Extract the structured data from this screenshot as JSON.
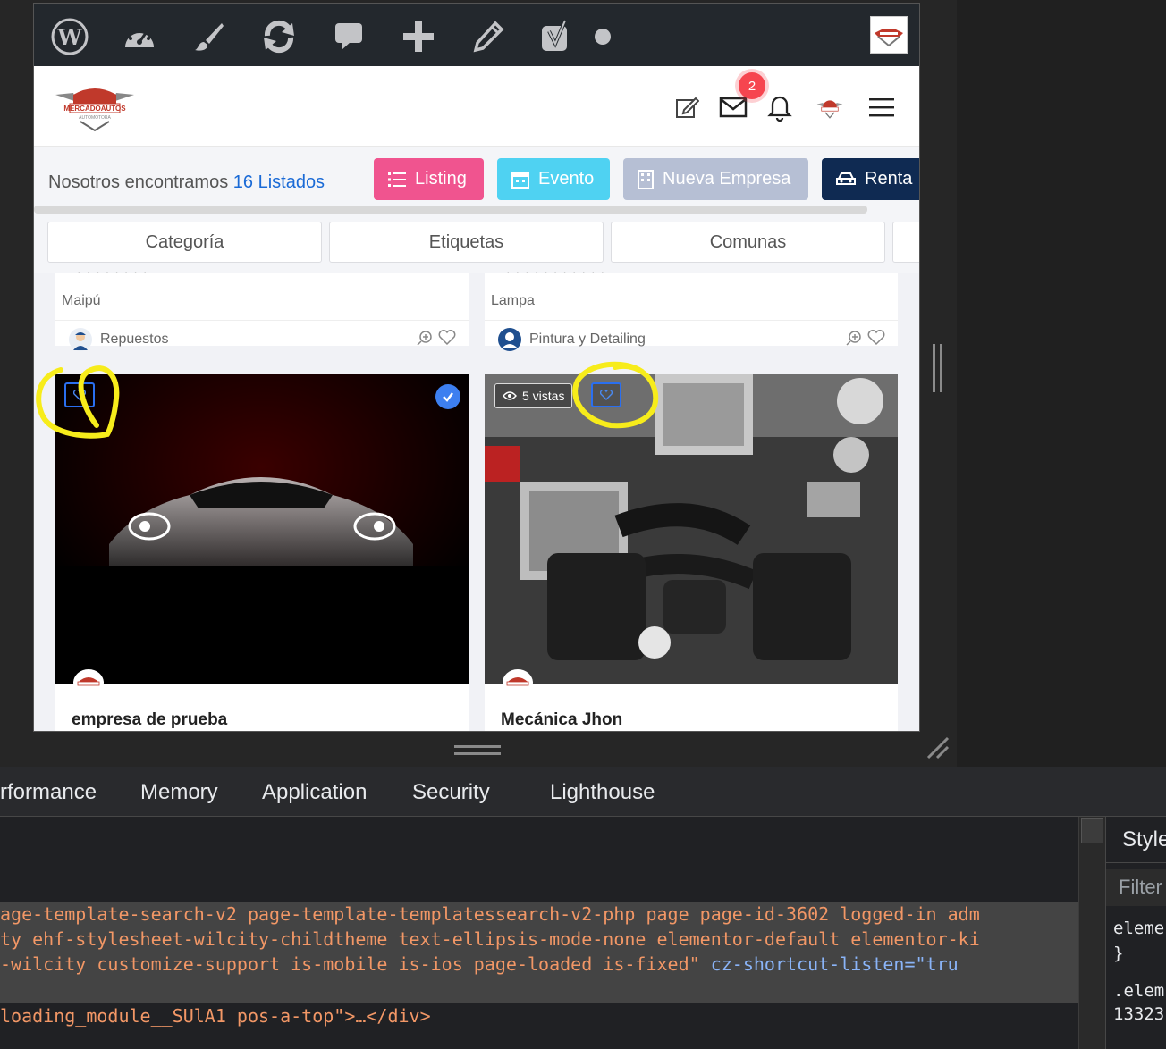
{
  "admin_bar": {
    "icons": [
      "wordpress-icon",
      "dashboard-icon",
      "customize-brush-icon",
      "updates-icon",
      "comments-icon",
      "new-content-icon",
      "edit-icon",
      "yoast-icon",
      "status-dot-icon"
    ]
  },
  "header": {
    "logo_text": "MERCADOAUTOS",
    "logo_sub": "AUTOMOTORA",
    "mail_badge": "2"
  },
  "found_bar": {
    "prefix": "Nosotros encontramos",
    "count": "16 Listados",
    "buttons": [
      {
        "label": "Listing",
        "color": "#f0548f"
      },
      {
        "label": "Evento",
        "color": "#4fd2f2"
      },
      {
        "label": "Nueva Empresa",
        "color": "#b6bfd4"
      },
      {
        "label": "Renta",
        "color": "#0f2a52"
      }
    ]
  },
  "filters": [
    "Categoría",
    "Etiquetas",
    "Comunas"
  ],
  "top_cards": [
    {
      "location": "Maipú",
      "category": "Repuestos"
    },
    {
      "location": "Lampa",
      "category": "Pintura y Detailing"
    }
  ],
  "cards": [
    {
      "title": "empresa de prueba",
      "verified": true
    },
    {
      "title": "Mecánica Jhon",
      "views": "5 vistas"
    }
  ],
  "devtools": {
    "tabs": [
      "rformance",
      "Memory",
      "Application",
      "Security",
      "Lighthouse"
    ],
    "code_lines": [
      "age-template-search-v2 page-template-templatessearch-v2-php page page-id-3602 logged-in adm",
      "ty ehf-stylesheet-wilcity-childtheme text-ellipsis-mode-none elementor-default elementor-ki",
      "-wilcity customize-support is-mobile is-ios page-loaded is-fixed\"",
      "loading_module__SUlA1 pos-a-top\">…</div>"
    ],
    "code_attr": " cz-shortcut-listen=\"tru",
    "styles": {
      "title": "Style",
      "filter": "Filter",
      "lines": [
        "eleme",
        "}",
        ".elem",
        "13323"
      ]
    }
  }
}
